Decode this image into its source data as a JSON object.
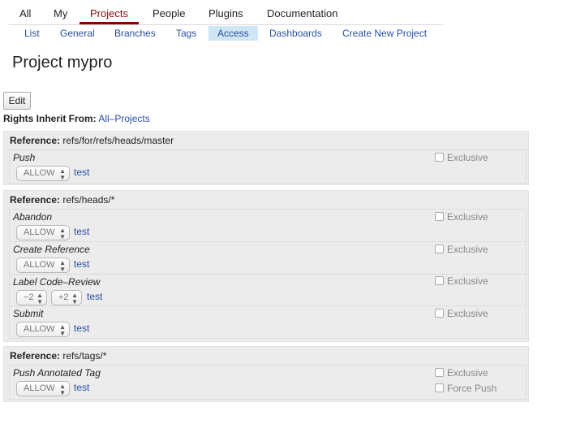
{
  "top_menu": {
    "items": [
      "All",
      "My",
      "Projects",
      "People",
      "Plugins",
      "Documentation"
    ],
    "active": "Projects"
  },
  "sub_menu": {
    "items": [
      "List",
      "General",
      "Branches",
      "Tags",
      "Access",
      "Dashboards",
      "Create New Project"
    ],
    "active": "Access"
  },
  "page": {
    "title": "Project mypro",
    "edit_label": "Edit",
    "inherit_label": "Rights Inherit From:",
    "inherit_value": "All–Projects",
    "reference_label": "Reference:"
  },
  "sections": [
    {
      "reference": "refs/for/refs/heads/master",
      "permissions": [
        {
          "name": "Push",
          "action": "ALLOW",
          "group": "test",
          "options": [
            "Exclusive"
          ]
        }
      ]
    },
    {
      "reference": "refs/heads/*",
      "permissions": [
        {
          "name": "Abandon",
          "action": "ALLOW",
          "group": "test",
          "options": [
            "Exclusive"
          ]
        },
        {
          "name": "Create Reference",
          "action": "ALLOW",
          "group": "test",
          "options": [
            "Exclusive"
          ]
        },
        {
          "name": "Label Code–Review",
          "range_min": "−2",
          "range_max": "+2",
          "group": "test",
          "options": [
            "Exclusive"
          ]
        },
        {
          "name": "Submit",
          "action": "ALLOW",
          "group": "test",
          "options": [
            "Exclusive"
          ]
        }
      ]
    },
    {
      "reference": "refs/tags/*",
      "permissions": [
        {
          "name": "Push Annotated Tag",
          "action": "ALLOW",
          "group": "test",
          "options": [
            "Exclusive",
            "Force Push"
          ]
        }
      ]
    }
  ],
  "colors": {
    "active_tab": "#8b0000",
    "active_subtab_bg": "#d0e6f5",
    "link": "#2a4fa3",
    "section_bg": "#ececec"
  }
}
